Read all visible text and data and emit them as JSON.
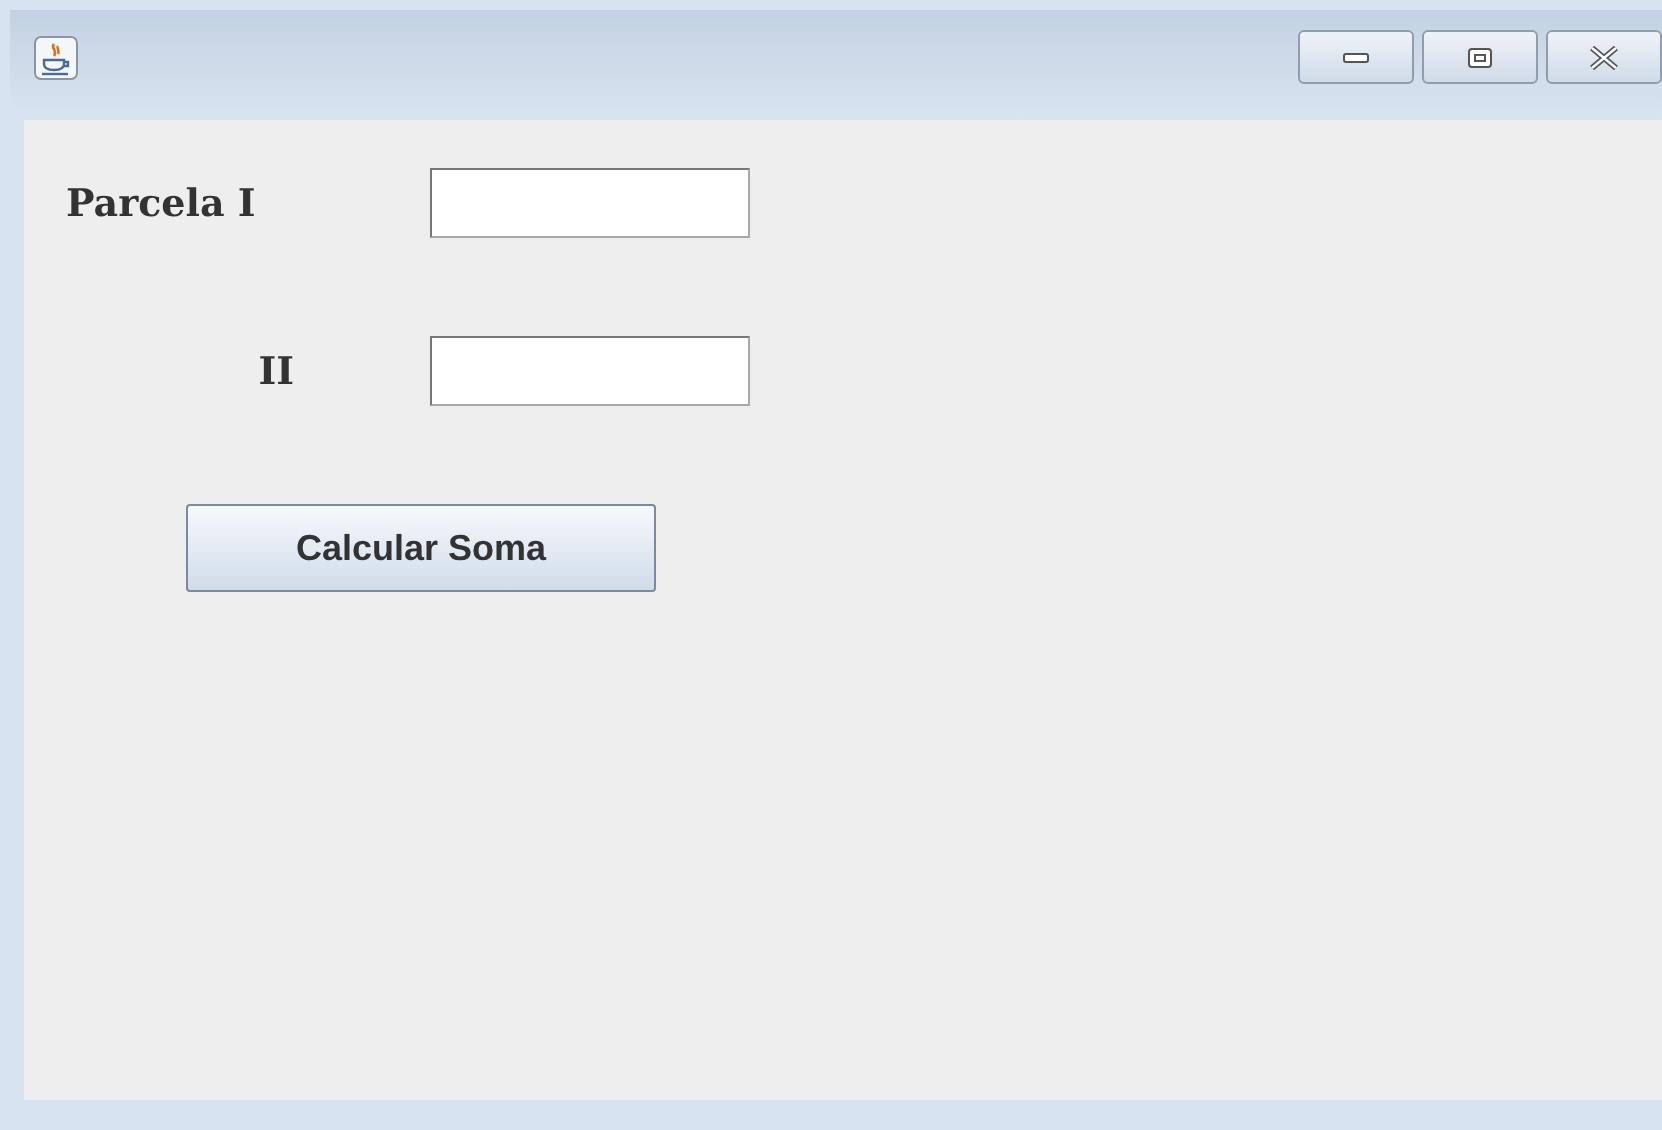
{
  "fields": [
    {
      "label": "Parcela I"
    },
    {
      "label": "II"
    }
  ],
  "button": "Calcular Soma"
}
